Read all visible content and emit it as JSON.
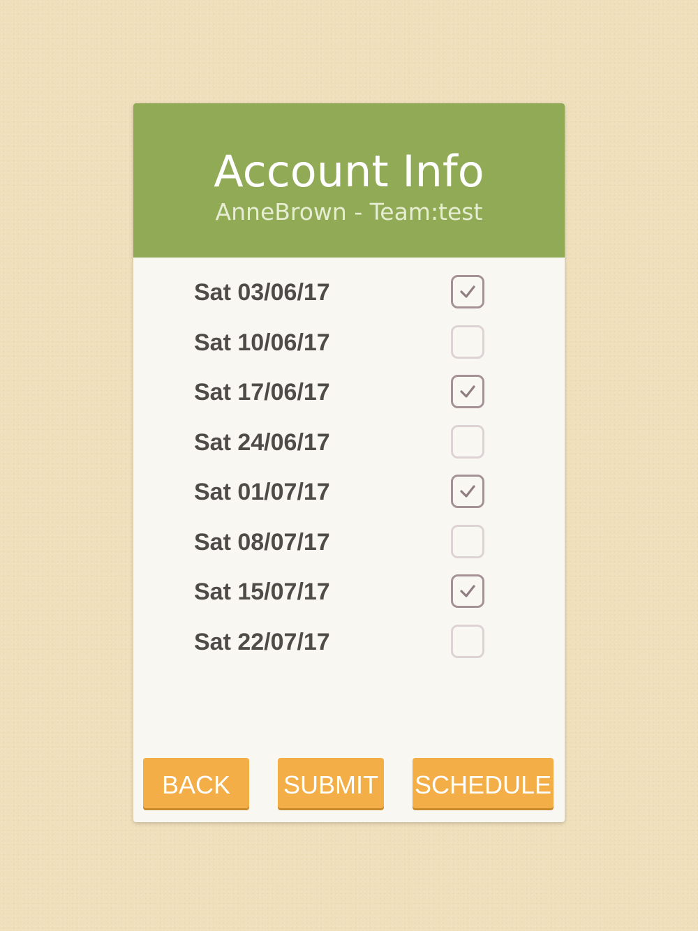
{
  "header": {
    "title": "Account Info",
    "subtitle": "AnneBrown - Team:test"
  },
  "dates": [
    {
      "label": "Sat 03/06/17",
      "checked": true
    },
    {
      "label": "Sat 10/06/17",
      "checked": false
    },
    {
      "label": "Sat 17/06/17",
      "checked": true
    },
    {
      "label": "Sat 24/06/17",
      "checked": false
    },
    {
      "label": "Sat 01/07/17",
      "checked": true
    },
    {
      "label": "Sat 08/07/17",
      "checked": false
    },
    {
      "label": "Sat 15/07/17",
      "checked": true
    },
    {
      "label": "Sat 22/07/17",
      "checked": false
    }
  ],
  "buttons": {
    "back": "BACK",
    "submit": "SUBMIT",
    "schedule": "SCHEDULE"
  },
  "colors": {
    "background": "#efdfba",
    "header": "#90aa55",
    "button": "#f3ae47",
    "checkbox_checked": "#a59296",
    "checkbox_unchecked": "#ddd3d5",
    "date_text": "#4e4b48"
  },
  "icons": {
    "checkmark": "check-icon"
  }
}
